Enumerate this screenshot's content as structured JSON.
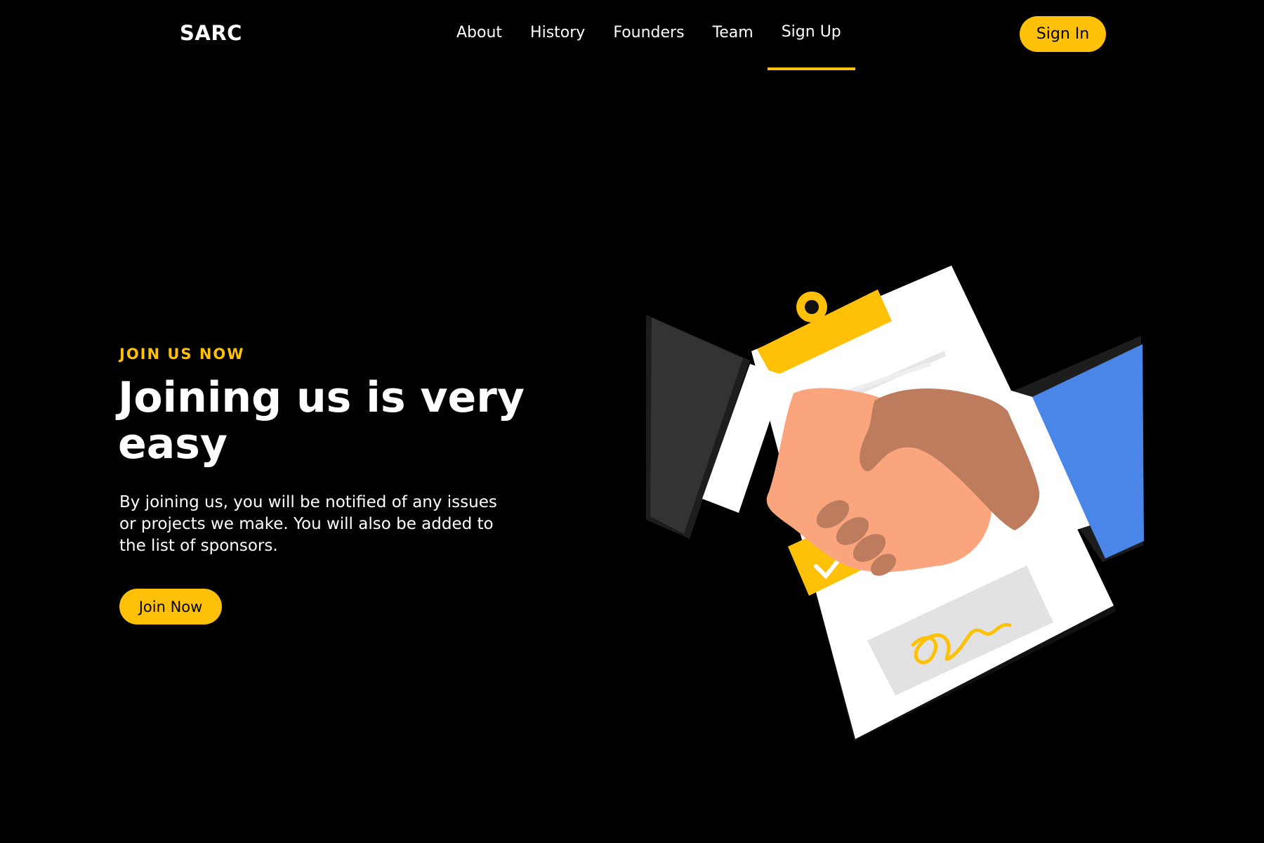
{
  "header": {
    "logo": "SARC",
    "nav": [
      {
        "label": "About",
        "active": false
      },
      {
        "label": "History",
        "active": false
      },
      {
        "label": "Founders",
        "active": false
      },
      {
        "label": "Team",
        "active": false
      },
      {
        "label": "Sign Up",
        "active": true
      }
    ],
    "signin_label": "Sign In"
  },
  "hero": {
    "eyebrow": "JOIN US NOW",
    "headline": "Joining us is very easy",
    "body": "By joining us, you will be notified of any issues or projects we make. You will also be added to the list of sponsors.",
    "cta_label": "Join Now"
  },
  "illustration": {
    "icon": "handshake-contract-illustration"
  },
  "colors": {
    "background": "#000000",
    "accent": "#ffc107",
    "text": "#ffffff"
  }
}
